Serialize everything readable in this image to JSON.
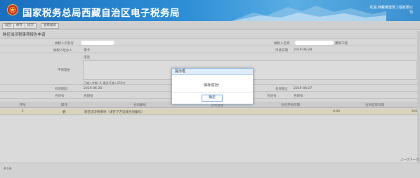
{
  "header": {
    "title": "国家税务总局西藏自治区电子税务局",
    "user_line1": "欢迎,西藏某建筑工程有限公",
    "user_line2": "司"
  },
  "toolbar": {
    "buttons": [
      "返回",
      "保存",
      "提交",
      "查看报表"
    ]
  },
  "page": {
    "title": "跨区域涉税事项报告申请"
  },
  "form": {
    "taxpayer_id_label": "纳税人识别号",
    "taxpayer_name_label": "纳税人名称",
    "taxpayer_name_suffix": "建筑工程",
    "applicant_label": "纳税人经办人",
    "applicant_value": "李卡",
    "apply_date_label": "申请日期",
    "apply_date_value": "2019-06-28",
    "contact_label": "电话",
    "address_label": "申请理由",
    "note_hint": "已输入字数: 0, 最多可输入255字",
    "valid_from_label": "有效期起",
    "valid_from_value": "2019-06-28",
    "valid_to_label": "有效期止",
    "valid_to_value": "2019-08-27",
    "contract_label": "合同号",
    "contract_value": "合同号",
    "contract2_label": "合同号",
    "contract2_value": "合同号"
  },
  "table": {
    "headers": [
      "序号",
      "操作",
      "合同编号",
      "合同金额",
      "合同开始日期",
      "合同结束日期"
    ],
    "row": {
      "index": "1",
      "op": "删",
      "name": "跨区域涉税事项（请在下方选择合同编号）",
      "amount": "0.00",
      "start": "2019",
      "end": "2019"
    }
  },
  "footer": {
    "left": "共1条",
    "prev": "上一页",
    "next": "下一页"
  },
  "dialog": {
    "title": "提示框",
    "message": "保存成功！",
    "ok": "确定"
  }
}
